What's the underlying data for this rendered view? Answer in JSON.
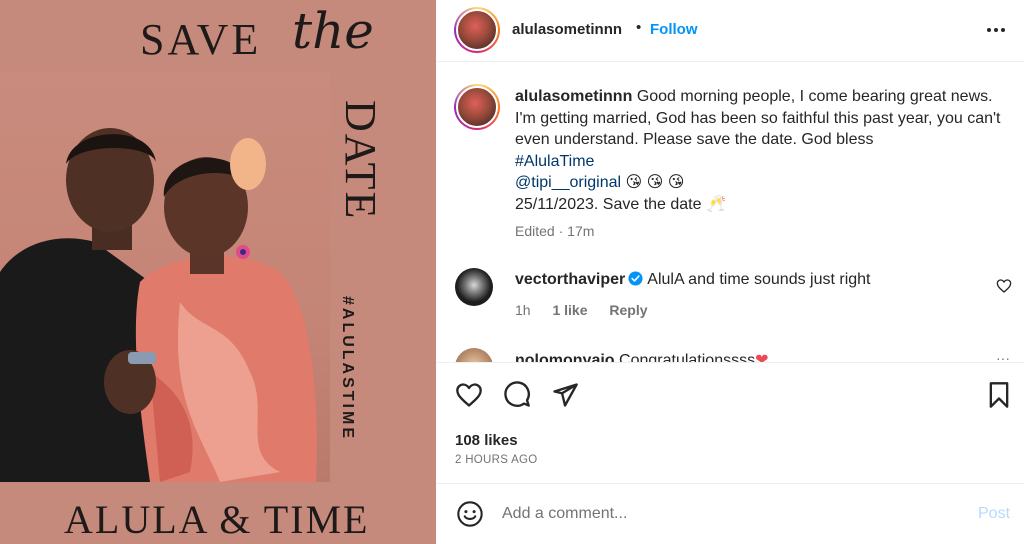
{
  "image": {
    "save_text": "SAVE",
    "the_text": "the",
    "date_text": "DATE",
    "hashtag_text": "#ALULASTIME",
    "names_text": "ALULA & TIME",
    "background_color": "#c58a7c"
  },
  "header": {
    "username": "alulasometinnn",
    "separator": "•",
    "follow_label": "Follow",
    "more_icon": "more-horizontal-icon"
  },
  "caption": {
    "username": "alulasometinnn",
    "text": "Good morning people, I come bearing great news. I'm getting married, God has been so faithful this past year, you can't even understand. Please save the date. God bless",
    "hashtag": "#AlulaTime",
    "mention": "@tipi__original",
    "mention_emojis": "😘 😘 😘",
    "date_line": "25/11/2023. Save the date 🥂",
    "edited": "Edited",
    "edited_sep": "·",
    "edited_time": "17m"
  },
  "comments": [
    {
      "username": "vectorthaviper",
      "verified": true,
      "text": "AlulA and time sounds just right",
      "time": "1h",
      "likes": "1 like",
      "reply_label": "Reply"
    },
    {
      "username": "nolomonyaio",
      "text": "Congratulationssss",
      "emoji": "❤"
    }
  ],
  "actions": {
    "like_icon": "heart-icon",
    "comment_icon": "comment-icon",
    "share_icon": "send-icon",
    "save_icon": "bookmark-icon"
  },
  "likes": "108 likes",
  "posted_ago": "2 HOURS AGO",
  "add_comment": {
    "placeholder": "Add a comment...",
    "post_label": "Post",
    "emoji_icon": "emoji-icon"
  },
  "colors": {
    "link_blue": "#0095f6",
    "hashtag_blue": "#00376b",
    "muted": "#737373",
    "post_disabled": "#b3dbff"
  }
}
